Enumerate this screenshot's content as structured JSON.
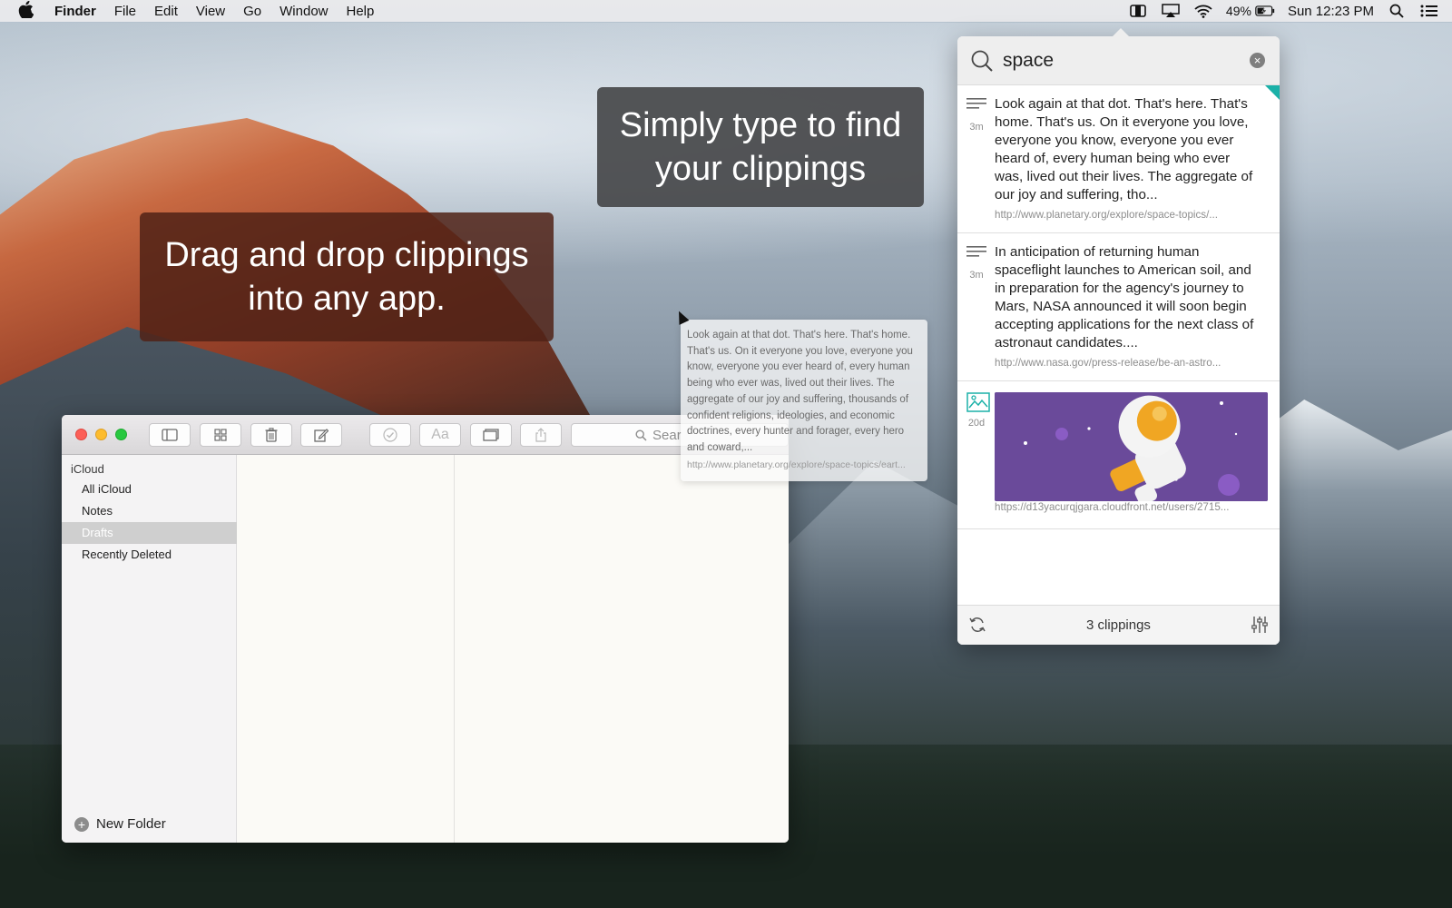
{
  "menubar": {
    "app_name": "Finder",
    "menus": [
      "File",
      "Edit",
      "View",
      "Go",
      "Window",
      "Help"
    ],
    "battery": "49%",
    "clock": "Sun 12:23 PM"
  },
  "callouts": {
    "find": "Simply type to find your clippings",
    "drag": "Drag and drop clippings into any app."
  },
  "notes_window": {
    "search_placeholder": "Sear",
    "account": "iCloud",
    "folders": [
      "All iCloud",
      "Notes",
      "Drafts",
      "Recently Deleted"
    ],
    "selected_folder": "Drafts",
    "new_folder_label": "New Folder"
  },
  "drag_preview": {
    "text": "Look again at that dot. That's here. That's home. That's us. On it everyone you love, everyone you know, everyone you ever heard of, every human being who ever was, lived out their lives. The aggregate of our joy and suffering, thousands of confident religions, ideologies, and economic doctrines, every hunter and forager, every hero and coward,...",
    "url": "http://www.planetary.org/explore/space-topics/eart..."
  },
  "panel": {
    "query": "space",
    "clippings": [
      {
        "age": "3m",
        "kind": "text",
        "text": "Look again at that dot. That's here. That's home. That's us. On it everyone you love, everyone you know, everyone you ever heard of, every human being who ever was, lived out their lives. The aggregate of our joy and suffering, tho...",
        "url": "http://www.planetary.org/explore/space-topics/..."
      },
      {
        "age": "3m",
        "kind": "text",
        "text": "In anticipation of returning human spaceflight launches to American soil, and in preparation for the agency's journey to Mars, NASA announced it will soon begin accepting applications for the next class of astronaut candidates....",
        "url": "http://www.nasa.gov/press-release/be-an-astro..."
      },
      {
        "age": "20d",
        "kind": "image",
        "url": "https://d13yacurqjgara.cloudfront.net/users/2715..."
      }
    ],
    "count_label": "3 clippings"
  },
  "colors": {
    "accent_flag": "#1bb1a8",
    "image_bg": "#6a4a9a"
  }
}
